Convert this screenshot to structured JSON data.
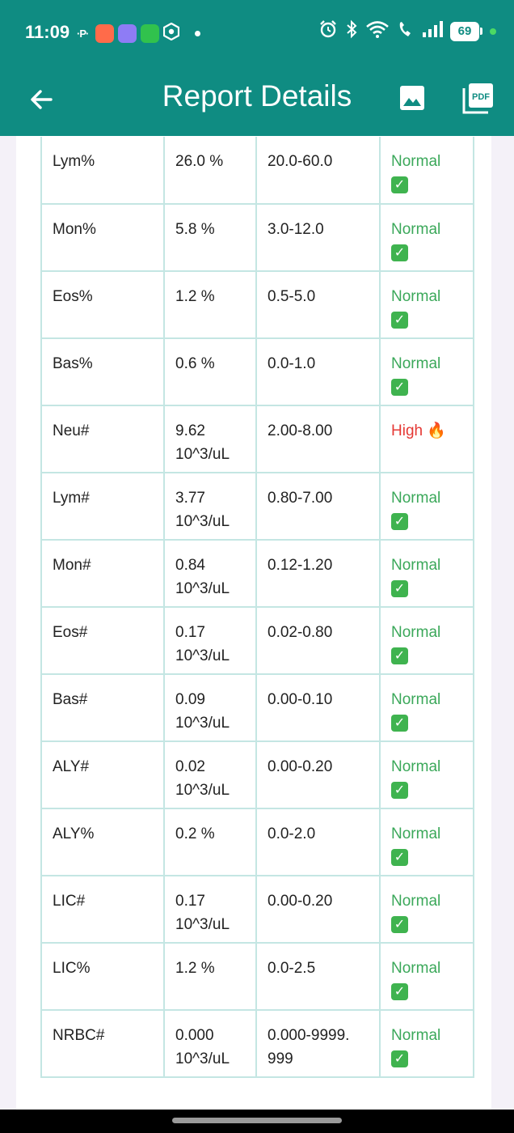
{
  "status_bar": {
    "time": "11:09",
    "p_badge": "·P·",
    "battery": "69"
  },
  "app_bar": {
    "title": "Report Details"
  },
  "colors": {
    "primary": "#0f8c82",
    "normal": "#3ba85a",
    "high": "#e53935",
    "table_border": "#c4e6e3"
  },
  "table": {
    "rows": [
      {
        "name": "Lym%",
        "value": "26.0 %",
        "unit": "",
        "range": "20.0-60.0",
        "status": "Normal",
        "status_type": "normal"
      },
      {
        "name": "Mon%",
        "value": "5.8 %",
        "unit": "",
        "range": "3.0-12.0",
        "status": "Normal",
        "status_type": "normal"
      },
      {
        "name": "Eos%",
        "value": "1.2 %",
        "unit": "",
        "range": "0.5-5.0",
        "status": "Normal",
        "status_type": "normal"
      },
      {
        "name": "Bas%",
        "value": "0.6 %",
        "unit": "",
        "range": "0.0-1.0",
        "status": "Normal",
        "status_type": "normal"
      },
      {
        "name": "Neu#",
        "value": "9.62",
        "unit": "10^3/uL",
        "range": "2.00-8.00",
        "status": "High",
        "status_type": "high"
      },
      {
        "name": "Lym#",
        "value": "3.77",
        "unit": "10^3/uL",
        "range": "0.80-7.00",
        "status": "Normal",
        "status_type": "normal"
      },
      {
        "name": "Mon#",
        "value": "0.84",
        "unit": "10^3/uL",
        "range": "0.12-1.20",
        "status": "Normal",
        "status_type": "normal"
      },
      {
        "name": "Eos#",
        "value": "0.17",
        "unit": "10^3/uL",
        "range": "0.02-0.80",
        "status": "Normal",
        "status_type": "normal"
      },
      {
        "name": "Bas#",
        "value": "0.09",
        "unit": "10^3/uL",
        "range": "0.00-0.10",
        "status": "Normal",
        "status_type": "normal"
      },
      {
        "name": "ALY#",
        "value": "0.02",
        "unit": "10^3/uL",
        "range": "0.00-0.20",
        "status": "Normal",
        "status_type": "normal"
      },
      {
        "name": "ALY%",
        "value": "0.2 %",
        "unit": "",
        "range": "0.0-2.0",
        "status": "Normal",
        "status_type": "normal"
      },
      {
        "name": "LIC#",
        "value": "0.17",
        "unit": "10^3/uL",
        "range": "0.00-0.20",
        "status": "Normal",
        "status_type": "normal"
      },
      {
        "name": "LIC%",
        "value": "1.2 %",
        "unit": "",
        "range": "0.0-2.5",
        "status": "Normal",
        "status_type": "normal"
      },
      {
        "name": "NRBC#",
        "value": "0.000",
        "unit": "10^3/uL",
        "range": "0.000-9999.",
        "range_cont": "999",
        "status": "Normal",
        "status_type": "normal"
      }
    ]
  }
}
